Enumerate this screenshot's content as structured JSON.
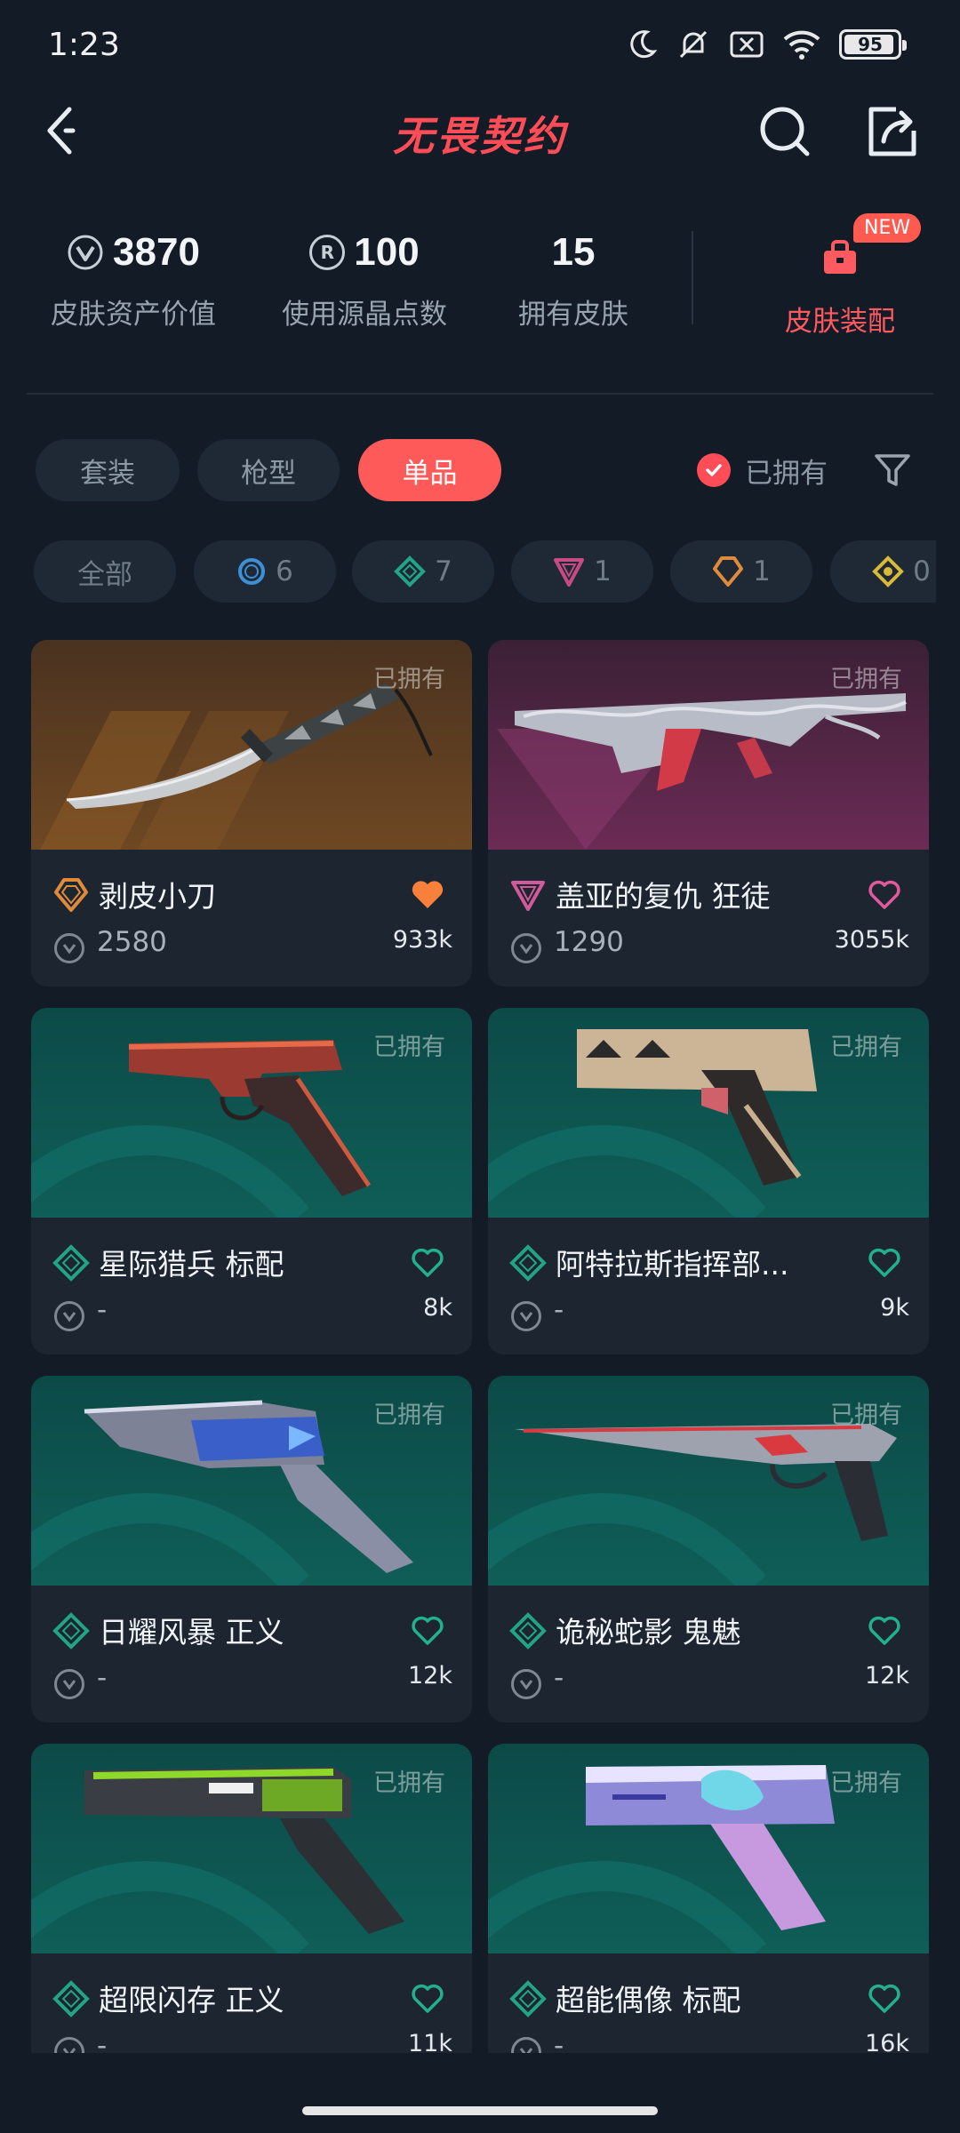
{
  "status": {
    "time": "1:23",
    "battery": "95",
    "battery_fraction": 0.95
  },
  "header": {
    "title": "无畏契约"
  },
  "stats": [
    {
      "value": "3870",
      "label": "皮肤资产价值",
      "icon": "vp-coin-icon"
    },
    {
      "value": "100",
      "label": "使用源晶点数",
      "icon": "radianite-icon"
    },
    {
      "value": "15",
      "label": "拥有皮肤",
      "icon": ""
    }
  ],
  "loadout": {
    "label": "皮肤装配",
    "badge": "NEW"
  },
  "tabs": [
    {
      "label": "套装",
      "active": false
    },
    {
      "label": "枪型",
      "active": false
    },
    {
      "label": "单品",
      "active": true
    }
  ],
  "owned_filter": {
    "label": "已拥有",
    "checked": true
  },
  "tier_chips": [
    {
      "label": "全部",
      "count": ""
    },
    {
      "label": "",
      "count": "6",
      "color": "#3d8fd6",
      "shape": "circle"
    },
    {
      "label": "",
      "count": "7",
      "color": "#22a487",
      "shape": "diamond"
    },
    {
      "label": "",
      "count": "1",
      "color": "#c74a86",
      "shape": "triangle"
    },
    {
      "label": "",
      "count": "1",
      "color": "#e08a3c",
      "shape": "pentagon"
    },
    {
      "label": "",
      "count": "0",
      "color": "#d8b93a",
      "shape": "diamond-gold"
    }
  ],
  "cards": [
    {
      "name": "剥皮小刀",
      "price": "2580",
      "likes": "933k",
      "owned_label": "已拥有",
      "tier_color": "#e08a3c",
      "tier_shape": "pentagon",
      "liked": true,
      "heart_color": "#f7813a",
      "bg": "orange",
      "weapon": "knife"
    },
    {
      "name": "盖亚的复仇 狂徒",
      "price": "1290",
      "likes": "3055k",
      "owned_label": "已拥有",
      "tier_color": "#d05a9a",
      "tier_shape": "triangle",
      "liked": false,
      "heart_color": "#e05a9c",
      "bg": "magenta",
      "weapon": "rifle"
    },
    {
      "name": "星际猎兵 标配",
      "price": "-",
      "likes": "8k",
      "owned_label": "已拥有",
      "tier_color": "#22a487",
      "tier_shape": "diamond",
      "liked": false,
      "heart_color": "#22b08f",
      "bg": "teal",
      "weapon": "pistol-red"
    },
    {
      "name": "阿特拉斯指挥部...",
      "price": "-",
      "likes": "9k",
      "owned_label": "已拥有",
      "tier_color": "#22a487",
      "tier_shape": "diamond",
      "liked": false,
      "heart_color": "#22b08f",
      "bg": "teal",
      "weapon": "pistol-tan"
    },
    {
      "name": "日耀风暴 正义",
      "price": "-",
      "likes": "12k",
      "owned_label": "已拥有",
      "tier_color": "#22a487",
      "tier_shape": "diamond",
      "liked": false,
      "heart_color": "#22b08f",
      "bg": "teal",
      "weapon": "revolver-blue"
    },
    {
      "name": "诡秘蛇影 鬼魅",
      "price": "-",
      "likes": "12k",
      "owned_label": "已拥有",
      "tier_color": "#22a487",
      "tier_shape": "diamond",
      "liked": false,
      "heart_color": "#22b08f",
      "bg": "teal",
      "weapon": "pistol-long"
    },
    {
      "name": "超限闪存 正义",
      "price": "-",
      "likes": "11k",
      "owned_label": "已拥有",
      "tier_color": "#22a487",
      "tier_shape": "diamond",
      "liked": false,
      "heart_color": "#22b08f",
      "bg": "teal",
      "weapon": "revolver-green"
    },
    {
      "name": "超能偶像 标配",
      "price": "-",
      "likes": "16k",
      "owned_label": "已拥有",
      "tier_color": "#22a487",
      "tier_shape": "diamond",
      "liked": false,
      "heart_color": "#22b08f",
      "bg": "teal",
      "weapon": "pistol-anime"
    }
  ]
}
